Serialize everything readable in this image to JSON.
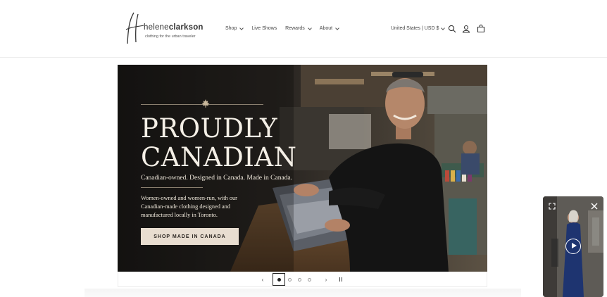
{
  "brand": {
    "name_light": "helene",
    "name_bold": "clarkson",
    "tagline": "clothing for the urban traveler"
  },
  "nav": {
    "items": [
      {
        "label": "Shop",
        "dropdown": true
      },
      {
        "label": "Live Shows",
        "dropdown": false
      },
      {
        "label": "Rewards",
        "dropdown": true
      },
      {
        "label": "About",
        "dropdown": true
      }
    ]
  },
  "header": {
    "locale": "United States | USD $",
    "icons": [
      "search-icon",
      "account-icon",
      "cart-icon"
    ]
  },
  "hero": {
    "title_line1": "PROUDLY",
    "title_line2": "CANADIAN",
    "subtitle": "Canadian-owned. Designed in Canada. Made in Canada.",
    "body": "Women-owned and women-run, with our Canadian-made clothing designed and manufactured locally in Toronto.",
    "cta": "SHOP MADE IN CANADA"
  },
  "slider": {
    "slide_count": 4,
    "active_slide": 1,
    "prev_icon": "chevron-left-icon",
    "next_icon": "chevron-right-icon",
    "pause_icon": "pause-icon"
  },
  "video_popup": {
    "icons": [
      "expand-icon",
      "close-icon",
      "play-icon"
    ]
  },
  "colors": {
    "accent_button": "#e8ddd0",
    "hero_text": "#f4efe6",
    "video_dress": "#1e3470"
  }
}
